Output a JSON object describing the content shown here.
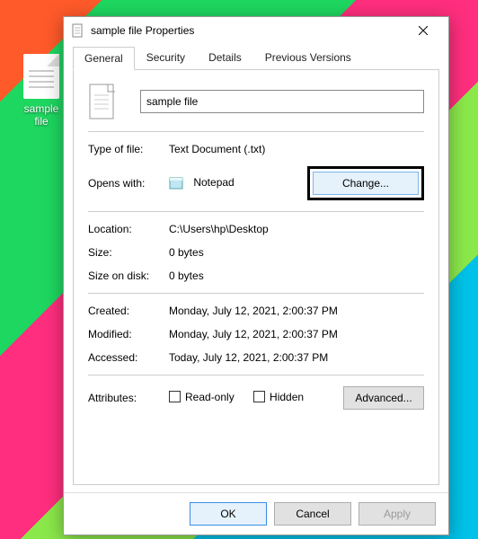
{
  "desktop": {
    "file_label": "sample file"
  },
  "dialog": {
    "title": "sample file Properties",
    "tabs": [
      "General",
      "Security",
      "Details",
      "Previous Versions"
    ],
    "filename": "sample file",
    "labels": {
      "type_of_file": "Type of file:",
      "opens_with": "Opens with:",
      "location": "Location:",
      "size": "Size:",
      "size_on_disk": "Size on disk:",
      "created": "Created:",
      "modified": "Modified:",
      "accessed": "Accessed:",
      "attributes": "Attributes:"
    },
    "values": {
      "type_of_file": "Text Document (.txt)",
      "opens_with": "Notepad",
      "location": "C:\\Users\\hp\\Desktop",
      "size": "0 bytes",
      "size_on_disk": "0 bytes",
      "created": "Monday, July 12, 2021, 2:00:37 PM",
      "modified": "Monday, July 12, 2021, 2:00:37 PM",
      "accessed": "Today, July 12, 2021, 2:00:37 PM"
    },
    "checkboxes": {
      "read_only": "Read-only",
      "hidden": "Hidden"
    },
    "buttons": {
      "change": "Change...",
      "advanced": "Advanced...",
      "ok": "OK",
      "cancel": "Cancel",
      "apply": "Apply"
    }
  }
}
